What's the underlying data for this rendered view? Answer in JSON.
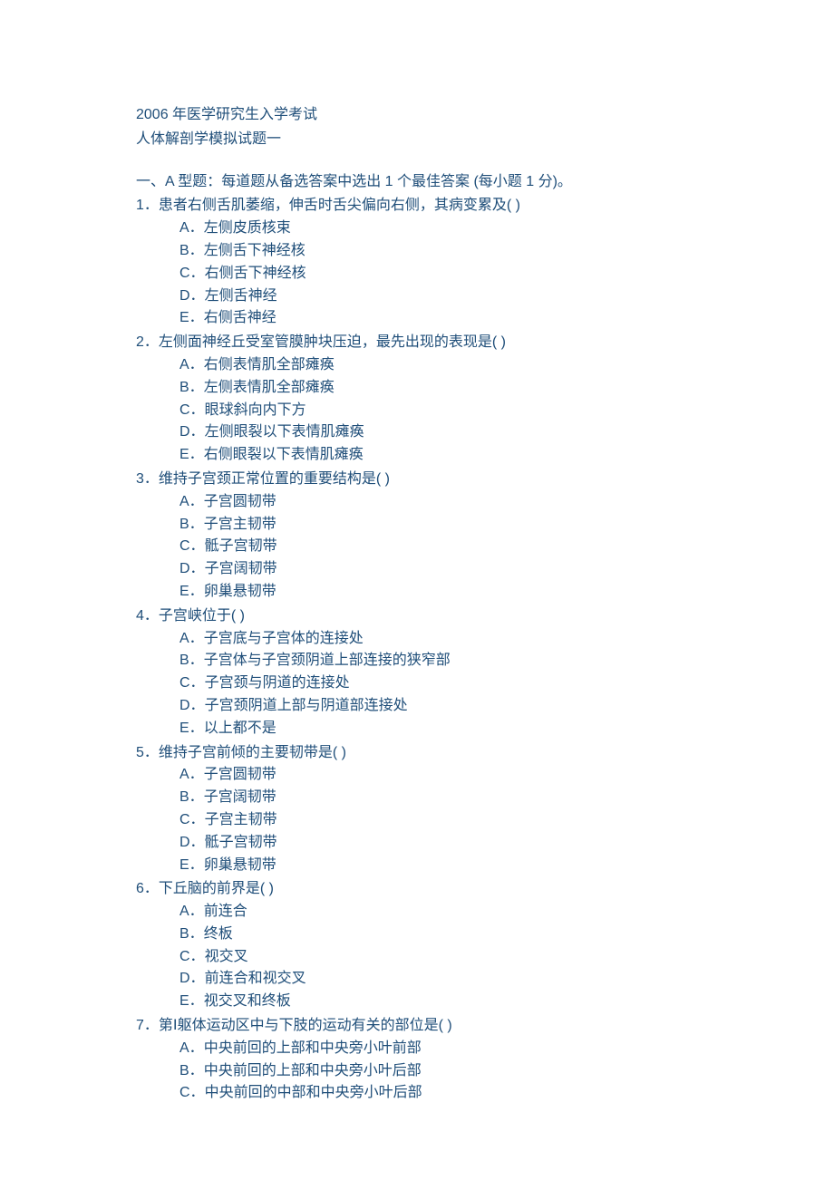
{
  "header": {
    "line1": "2006 年医学研究生入学考试",
    "line2": "人体解剖学模拟试题一"
  },
  "section_heading": "一、A 型题：每道题从备选答案中选出 1 个最佳答案  (每小题 1 分)。",
  "questions": [
    {
      "num": "1．",
      "stem": "患者右侧舌肌萎缩，伸舌时舌尖偏向右侧，其病变累及(   )",
      "options": [
        {
          "label": "A．",
          "text": "左侧皮质核束"
        },
        {
          "label": "B．",
          "text": "左侧舌下神经核"
        },
        {
          "label": "C．",
          "text": "右侧舌下神经核"
        },
        {
          "label": "D．",
          "text": "左侧舌神经"
        },
        {
          "label": "E．",
          "text": "右侧舌神经"
        }
      ]
    },
    {
      "num": "2．",
      "stem": "左侧面神经丘受室管膜肿块压迫，最先出现的表现是(   )",
      "options": [
        {
          "label": "A．",
          "text": "右侧表情肌全部瘫痪"
        },
        {
          "label": "B．",
          "text": "左侧表情肌全部瘫痪"
        },
        {
          "label": "C．",
          "text": "眼球斜向内下方"
        },
        {
          "label": "D．",
          "text": "左侧眼裂以下表情肌瘫痪"
        },
        {
          "label": "E．",
          "text": "右侧眼裂以下表情肌瘫痪"
        }
      ]
    },
    {
      "num": "3．",
      "stem": "维持子宫颈正常位置的重要结构是(   )",
      "options": [
        {
          "label": "A．",
          "text": "子宫圆韧带"
        },
        {
          "label": "B．",
          "text": "子宫主韧带"
        },
        {
          "label": "C．",
          "text": "骶子宫韧带"
        },
        {
          "label": "D．",
          "text": "子宫阔韧带"
        },
        {
          "label": "E．",
          "text": "卵巢悬韧带"
        }
      ]
    },
    {
      "num": "4．",
      "stem": "子宫峡位于(   )",
      "options": [
        {
          "label": "A．",
          "text": "子宫底与子宫体的连接处"
        },
        {
          "label": "B．",
          "text": "子宫体与子宫颈阴道上部连接的狭窄部"
        },
        {
          "label": "C．",
          "text": "子宫颈与阴道的连接处"
        },
        {
          "label": "D．",
          "text": "子宫颈阴道上部与阴道部连接处"
        },
        {
          "label": "E．",
          "text": "以上都不是"
        }
      ]
    },
    {
      "num": "5．",
      "stem": "维持子宫前倾的主要韧带是(   )",
      "options": [
        {
          "label": "A．",
          "text": "子宫圆韧带"
        },
        {
          "label": "B．",
          "text": "子宫阔韧带"
        },
        {
          "label": "C．",
          "text": "子宫主韧带"
        },
        {
          "label": "D．",
          "text": "骶子宫韧带"
        },
        {
          "label": "E．",
          "text": "卵巢悬韧带"
        }
      ]
    },
    {
      "num": "6．",
      "stem": "下丘脑的前界是(   )",
      "options": [
        {
          "label": "A．",
          "text": "前连合"
        },
        {
          "label": "B．",
          "text": "终板"
        },
        {
          "label": "C．",
          "text": "视交叉"
        },
        {
          "label": "D．",
          "text": "前连合和视交叉"
        },
        {
          "label": "E．",
          "text": "视交叉和终板"
        }
      ]
    },
    {
      "num": "7．",
      "stem": "第Ⅰ躯体运动区中与下肢的运动有关的部位是(   )",
      "options": [
        {
          "label": "A．",
          "text": "中央前回的上部和中央旁小叶前部"
        },
        {
          "label": "B．",
          "text": "中央前回的上部和中央旁小叶后部"
        },
        {
          "label": "C．",
          "text": "中央前回的中部和中央旁小叶后部"
        }
      ]
    }
  ]
}
